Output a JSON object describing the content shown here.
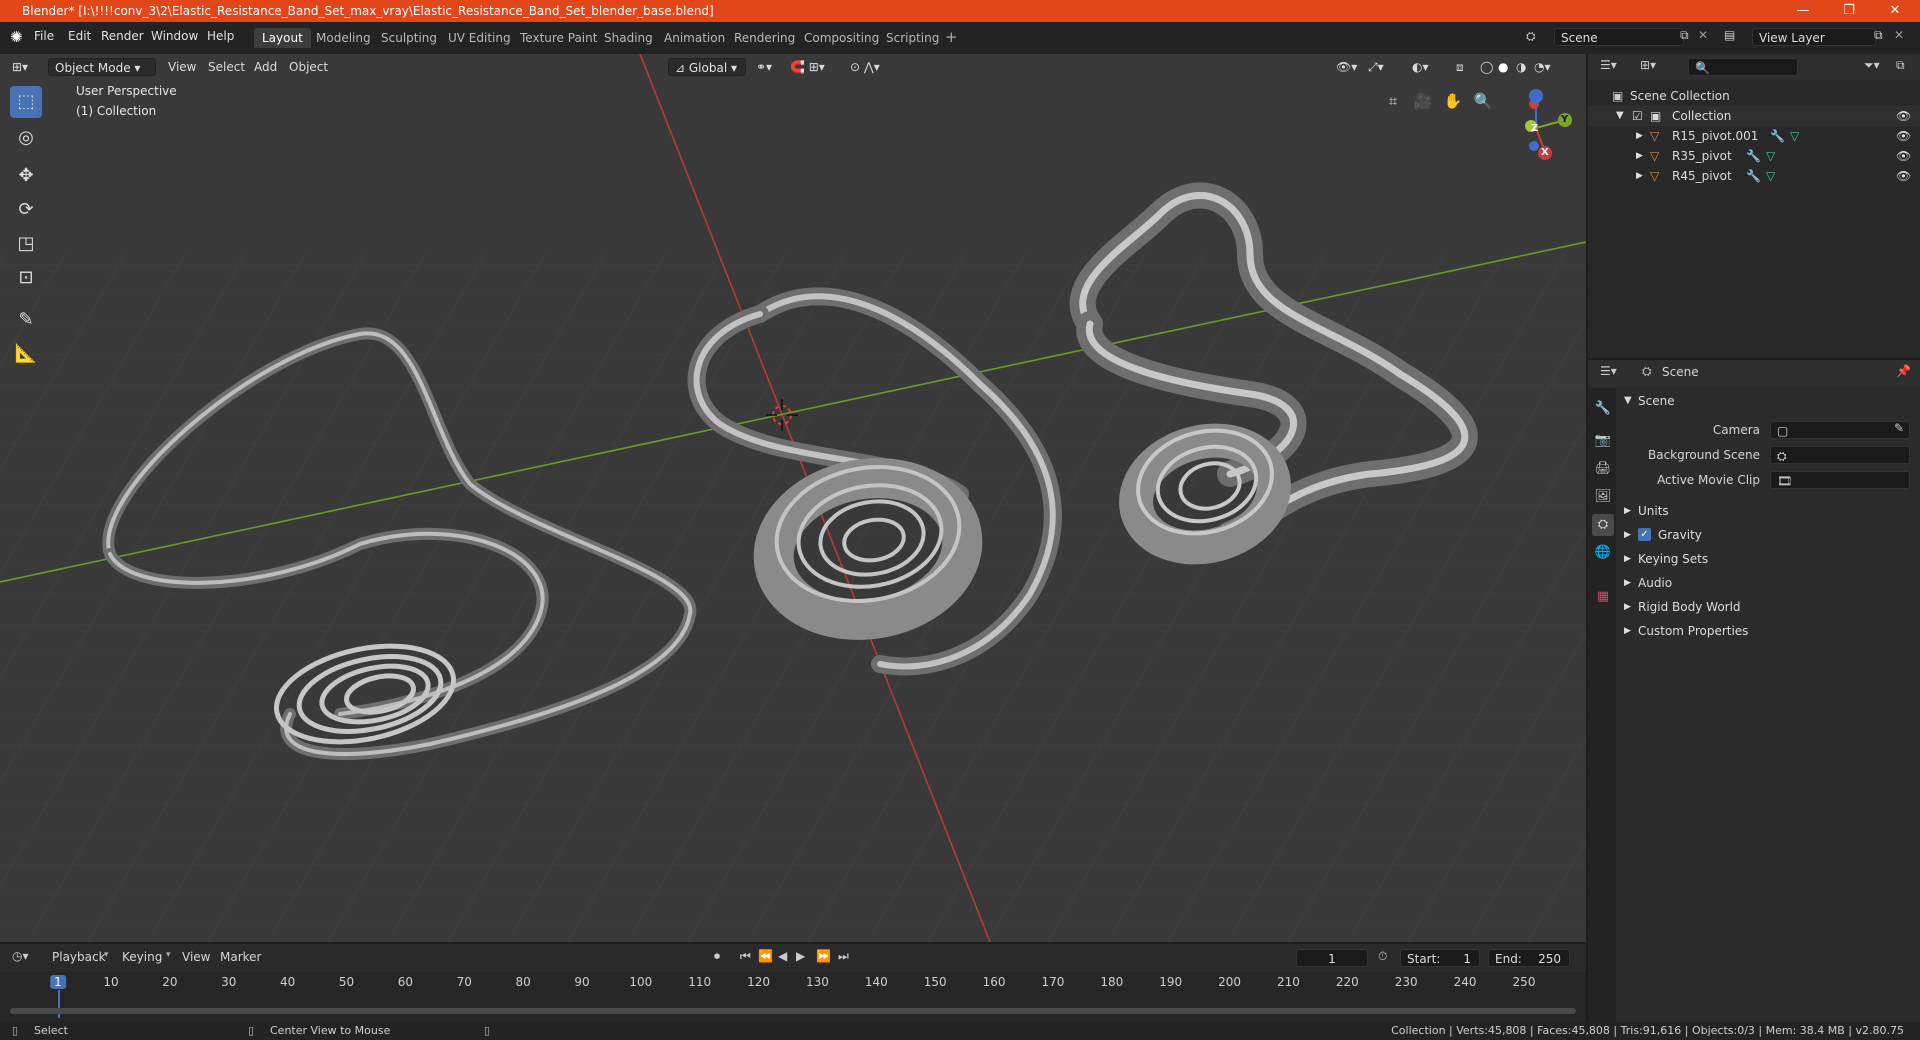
{
  "window": {
    "title": "Blender* [I:\\!!!!conv_3\\2\\Elastic_Resistance_Band_Set_max_vray\\Elastic_Resistance_Band_Set_blender_base.blend]",
    "minimize": "—",
    "maximize": "❐",
    "close": "✕"
  },
  "menu": [
    "File",
    "Edit",
    "Render",
    "Window",
    "Help"
  ],
  "workspaces": [
    "Layout",
    "Modeling",
    "Sculpting",
    "UV Editing",
    "Texture Paint",
    "Shading",
    "Animation",
    "Rendering",
    "Compositing",
    "Scripting"
  ],
  "scene_field": "Scene",
  "view_layer_field": "View Layer",
  "viewport": {
    "mode": "Object Mode",
    "menus": [
      "View",
      "Select",
      "Add",
      "Object"
    ],
    "orientation": "Global",
    "perspective_label": "User Perspective",
    "collection_label": "(1) Collection",
    "gizmo_axes": {
      "z": "Z",
      "y": "Y",
      "x": "X"
    }
  },
  "outliner": {
    "root": "Scene Collection",
    "collection": "Collection",
    "objects": [
      "R15_pivot.001",
      "R35_pivot",
      "R45_pivot"
    ]
  },
  "properties": {
    "header": "Scene",
    "panel_title": "Scene",
    "fields": [
      {
        "label": "Camera"
      },
      {
        "label": "Background Scene"
      },
      {
        "label": "Active Movie Clip"
      }
    ],
    "subpanels": [
      "Units",
      "Gravity",
      "Keying Sets",
      "Audio",
      "Rigid Body World",
      "Custom Properties"
    ]
  },
  "timeline": {
    "menus": [
      "Playback",
      "Keying",
      "View",
      "Marker"
    ],
    "current_frame": "1",
    "start_label": "Start:",
    "start_value": "1",
    "end_label": "End:",
    "end_value": "250",
    "ticks": [
      "1",
      "10",
      "20",
      "30",
      "40",
      "50",
      "60",
      "70",
      "80",
      "90",
      "100",
      "110",
      "120",
      "130",
      "140",
      "150",
      "160",
      "170",
      "180",
      "190",
      "200",
      "210",
      "220",
      "230",
      "240",
      "250"
    ]
  },
  "status": {
    "left_action": "Select",
    "middle_action": "Center View to Mouse",
    "stats": "Collection | Verts:45,808 | Faces:45,808 | Tris:91,616 | Objects:0/3 | Mem: 38.4 MB | v2.80.75"
  },
  "colors": {
    "titlebar": "#e2471a",
    "accent": "#4772b3",
    "axis_x": "#b53a3a",
    "axis_y": "#6b9a29"
  }
}
